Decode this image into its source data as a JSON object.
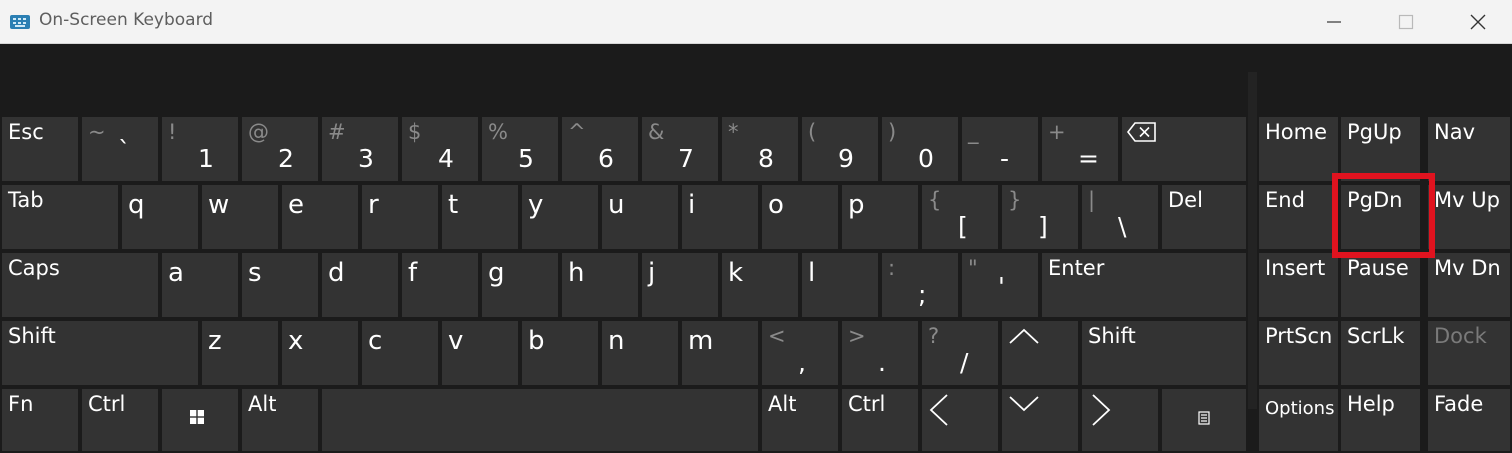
{
  "window": {
    "title": "On-Screen Keyboard",
    "icon": "keyboard-icon",
    "controls": [
      "minimize-icon",
      "maximize-icon",
      "close-icon"
    ]
  },
  "keys": {
    "row1": {
      "esc": "Esc",
      "tilde": {
        "shift": "~",
        "base": "`"
      },
      "k1": {
        "shift": "!",
        "base": "1"
      },
      "k2": {
        "shift": "@",
        "base": "2"
      },
      "k3": {
        "shift": "#",
        "base": "3"
      },
      "k4": {
        "shift": "$",
        "base": "4"
      },
      "k5": {
        "shift": "%",
        "base": "5"
      },
      "k6": {
        "shift": "^",
        "base": "6"
      },
      "k7": {
        "shift": "&",
        "base": "7"
      },
      "k8": {
        "shift": "*",
        "base": "8"
      },
      "k9": {
        "shift": "(",
        "base": "9"
      },
      "k0": {
        "shift": ")",
        "base": "0"
      },
      "minus": {
        "shift": "_",
        "base": "-"
      },
      "equals": {
        "shift": "+",
        "base": "="
      },
      "backspace": "backspace-icon"
    },
    "row2": {
      "tab": "Tab",
      "letters": [
        "q",
        "w",
        "e",
        "r",
        "t",
        "y",
        "u",
        "i",
        "o",
        "p"
      ],
      "lbracket": {
        "shift": "{",
        "base": "["
      },
      "rbracket": {
        "shift": "}",
        "base": "]"
      },
      "backslash": {
        "shift": "|",
        "base": "\\"
      },
      "del": "Del"
    },
    "row3": {
      "caps": "Caps",
      "letters": [
        "a",
        "s",
        "d",
        "f",
        "g",
        "h",
        "j",
        "k",
        "l"
      ],
      "semicolon": {
        "shift": ":",
        "base": ";"
      },
      "quote": {
        "shift": "\"",
        "base": "'"
      },
      "enter": "Enter"
    },
    "row4": {
      "lshift": "Shift",
      "letters": [
        "z",
        "x",
        "c",
        "v",
        "b",
        "n",
        "m"
      ],
      "comma": {
        "shift": "<",
        "base": ","
      },
      "period": {
        "shift": ">",
        "base": "."
      },
      "slash": {
        "shift": "?",
        "base": "/"
      },
      "up": "arrow-up-icon",
      "rshift": "Shift"
    },
    "row5": {
      "fn": "Fn",
      "lctrl": "Ctrl",
      "win": "windows-icon",
      "lalt": "Alt",
      "space": "",
      "ralt": "Alt",
      "rctrl": "Ctrl",
      "left": "arrow-left-icon",
      "down": "arrow-down-icon",
      "right": "arrow-right-icon",
      "menu": "menu-icon"
    },
    "nav": {
      "home": "Home",
      "pgup": "PgUp",
      "navkey": "Nav",
      "end": "End",
      "pgdn": "PgDn",
      "mvup": "Mv Up",
      "insert": "Insert",
      "pause": "Pause",
      "mvdn": "Mv Dn",
      "prtscn": "PrtScn",
      "scrlk": "ScrLk",
      "dock": "Dock",
      "options": "Options",
      "help": "Help",
      "fade": "Fade"
    }
  },
  "highlighted_key": "PgDn",
  "colors": {
    "titlebar": "#f3f3f3",
    "background": "#1b1b1b",
    "key": "#333333",
    "key_text": "#ffffff",
    "secondary_text": "#8a8a8a",
    "highlight": "#e0131f"
  }
}
